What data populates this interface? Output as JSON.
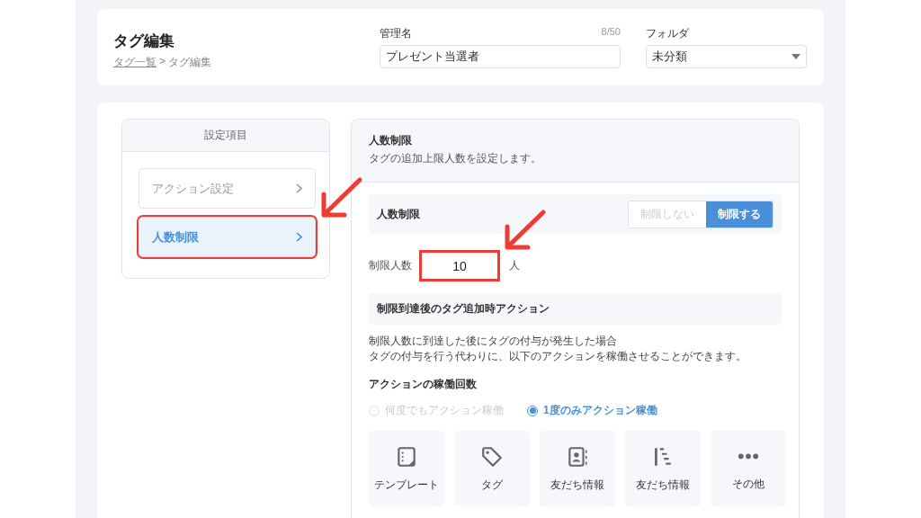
{
  "header": {
    "title": "タグ編集",
    "breadcrumb": [
      {
        "label": "タグ一覧",
        "link": true
      },
      {
        "label": "タグ編集",
        "link": false
      }
    ],
    "separator": ">",
    "name_field": {
      "label": "管理名",
      "counter": "8/50",
      "value": "プレゼント当選者"
    },
    "folder_field": {
      "label": "フォルダ",
      "value": "未分類"
    }
  },
  "sidebar": {
    "title": "設定項目",
    "items": [
      {
        "label": "アクション設定",
        "selected": false,
        "highlighted": false
      },
      {
        "label": "人数制限",
        "selected": true,
        "highlighted": true
      }
    ]
  },
  "panel": {
    "title": "人数制限",
    "description": "タグの追加上限人数を設定します。",
    "limit_toggle": {
      "label": "人数制限",
      "options": [
        {
          "label": "制限しない",
          "selected": false
        },
        {
          "label": "制限する",
          "selected": true
        }
      ]
    },
    "limit_count": {
      "label": "制限人数",
      "value": "10",
      "unit": "人",
      "highlighted": true
    },
    "section_title": "制限到達後のタグ追加時アクション",
    "notes": [
      "制限人数に到達した後にタグの付与が発生した場合",
      "タグの付与を行う代わりに、以下のアクションを稼働させることができます。"
    ],
    "run_count": {
      "title": "アクションの稼働回数",
      "options": [
        {
          "label": "何度でもアクション稼働",
          "selected": false
        },
        {
          "label": "1度のみアクション稼働",
          "selected": true
        }
      ]
    },
    "actions": [
      {
        "label": "テンプレート",
        "kind": "template"
      },
      {
        "label": "タグ",
        "kind": "tag"
      },
      {
        "label": "友だち情報",
        "kind": "contact"
      },
      {
        "label": "友だち情報",
        "kind": "list"
      },
      {
        "label": "その他",
        "kind": "more"
      }
    ]
  },
  "annotations": [
    {
      "kind": "arrow"
    },
    {
      "kind": "arrow"
    }
  ]
}
